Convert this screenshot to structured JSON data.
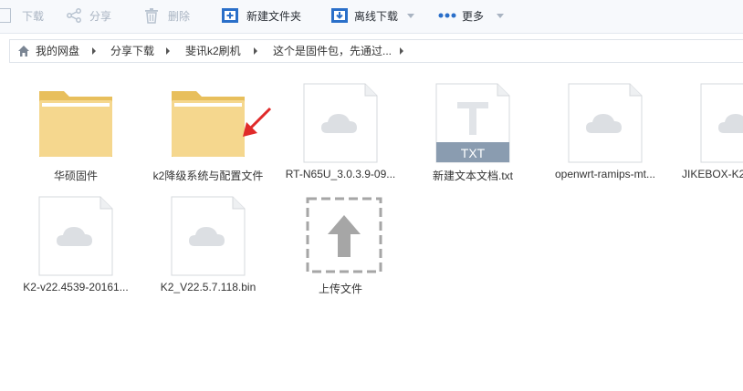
{
  "toolbar": {
    "download": "下载",
    "share": "分享",
    "delete": "删除",
    "new_folder": "新建文件夹",
    "offline_download": "离线下载",
    "more": "更多"
  },
  "breadcrumb": [
    "我的网盘",
    "分享下载",
    "斐讯k2刷机",
    "这个是固件包，先通过..."
  ],
  "files": [
    {
      "name": "华硕固件",
      "type": "folder"
    },
    {
      "name": "k2降级系统与配置文件",
      "type": "folder"
    },
    {
      "name": "RT-N65U_3.0.3.9-09...",
      "type": "file"
    },
    {
      "name": "新建文本文档.txt",
      "type": "txt",
      "badge": "TXT"
    },
    {
      "name": "openwrt-ramips-mt...",
      "type": "file"
    },
    {
      "name": "JIKEBOX-K2...",
      "type": "file"
    },
    {
      "name": "K2-v22.4539-20161...",
      "type": "file"
    },
    {
      "name": "K2_V22.5.7.118.bin",
      "type": "file"
    },
    {
      "name": "上传文件",
      "type": "upload"
    }
  ],
  "colors": {
    "folder": "#f5d78e",
    "folder_dark": "#e8bf5c",
    "toolbar_icon": "#2a6fc9",
    "disabled": "#a9b4c2",
    "annotation_arrow": "#e02a2a",
    "txt_band": "#8a9cb0"
  }
}
